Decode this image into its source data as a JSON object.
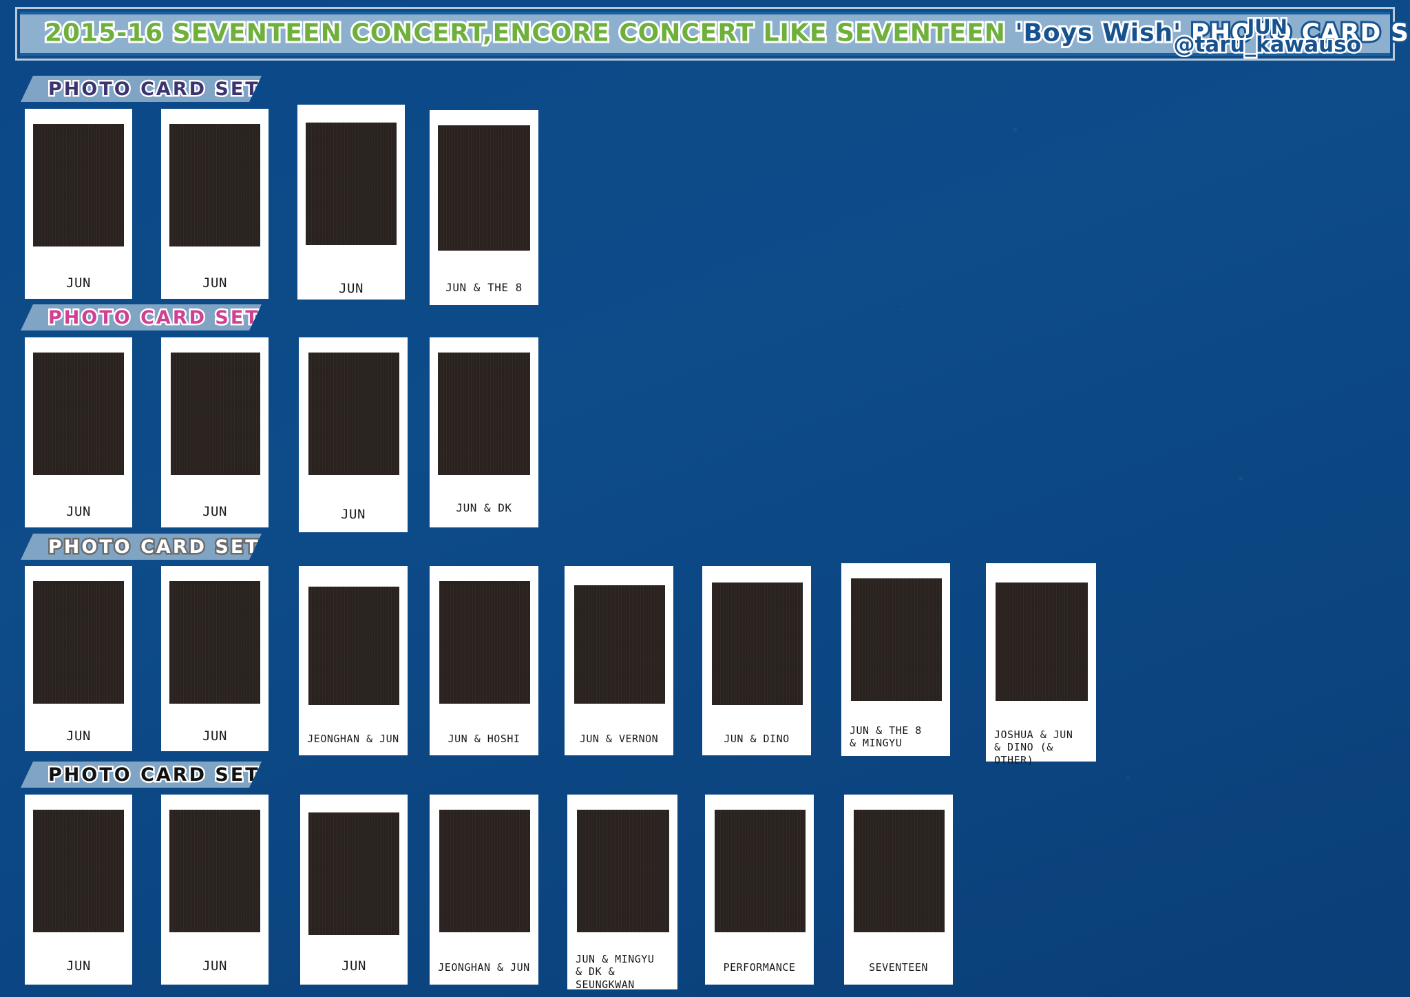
{
  "header": {
    "title_parts": [
      {
        "text": "2015-16 SEVENTEEN CONCERT,ENCORE CONCERT LIKE SEVENTEEN ",
        "color_class": "green"
      },
      {
        "text": "'Boys Wish' ",
        "color_class": "blue"
      },
      {
        "text": "PHOTO CARD SET",
        "color_class": "white"
      }
    ],
    "title_full": "2015-16 SEVENTEEN CONCERT,ENCORE CONCERT LIKE SEVENTEEN 'Boys Wish' PHOTO CARD SET",
    "title_green": "2015-16 SEVENTEEN CONCERT,ENCORE CONCERT LIKE SEVENTEEN ",
    "title_blue": "'Boys Wish' ",
    "title_white": "PHOTO CARD SET",
    "credit_name": "JUN",
    "credit_handle": "@taru_kawauso",
    "colors": {
      "background": "#0d4b89",
      "banner_fill": "#8cb0ce",
      "banner_border": "#1a5fa0",
      "title_green": "#6fb03c",
      "title_blue": "#17528f",
      "title_white": "#ffffff"
    }
  },
  "sections": [
    {
      "id": "set-a",
      "label": "PHOTO CARD SET A",
      "label_color": "#3c3470",
      "cards": [
        {
          "caption": "JUN",
          "photo": "jun-solo-black-tee"
        },
        {
          "caption": "JUN",
          "photo": "jun-striped-sleeve-dark"
        },
        {
          "caption": "JUN",
          "photo": "jun-suit-seated"
        },
        {
          "caption": "JUN & THE 8",
          "photo": "jun-and-the8-striped"
        }
      ]
    },
    {
      "id": "set-b",
      "label": "PHOTO CARD SET B",
      "label_color": "#d13f93",
      "cards": [
        {
          "caption": "JUN",
          "photo": "jun-seated-wall-striped"
        },
        {
          "caption": "JUN",
          "photo": "jun-blazer-portrait"
        },
        {
          "caption": "JUN",
          "photo": "jun-closeup-white-tee"
        },
        {
          "caption": "JUN & DK",
          "photo": "jun-and-dk-suits"
        }
      ]
    },
    {
      "id": "set-c",
      "label": "PHOTO CARD SET C",
      "label_color": "#ffffff",
      "cards": [
        {
          "caption": "JUN",
          "photo": "jun-black-jacket-stage"
        },
        {
          "caption": "JUN",
          "photo": "jun-lavender-hoodie"
        },
        {
          "caption": "JEONGHAN & JUN",
          "photo": "jeonghan-and-jun-lying"
        },
        {
          "caption": "JUN & HOSHI",
          "photo": "jun-and-hoshi-rehearsal"
        },
        {
          "caption": "JUN & VERNON",
          "photo": "jun-and-vernon-lying"
        },
        {
          "caption": "JUN & DINO",
          "photo": "jun-and-dino-room"
        },
        {
          "caption": "JUN & THE 8\n& MINGYU",
          "photo": "jun-the8-mingyu-table",
          "align": "left"
        },
        {
          "caption": "JOSHUA & JUN\n& DINO (& OTHER)",
          "photo": "joshua-jun-dino-outdoor",
          "align": "left"
        }
      ]
    },
    {
      "id": "set-d",
      "label": "PHOTO CARD SET D",
      "label_color": "#111111",
      "cards": [
        {
          "caption": "JUN",
          "photo": "jun-profile-dark"
        },
        {
          "caption": "JUN",
          "photo": "jun-with-flowers"
        },
        {
          "caption": "JUN",
          "photo": "jun-turtleneck-seated"
        },
        {
          "caption": "JEONGHAN & JUN",
          "photo": "jeonghan-and-jun-plaid"
        },
        {
          "caption": "JUN & MINGYU\n& DK & SEUNGKWAN",
          "photo": "jun-mingyu-dk-seungkwan",
          "align": "left"
        },
        {
          "caption": "PERFORMANCE",
          "photo": "performance-stage"
        },
        {
          "caption": "SEVENTEEN",
          "photo": "seventeen-group"
        }
      ]
    }
  ]
}
